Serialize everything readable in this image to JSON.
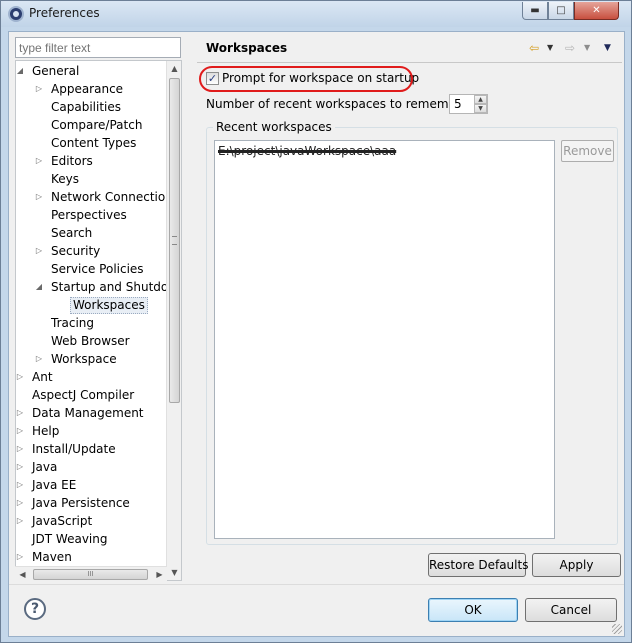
{
  "window": {
    "title": "Preferences",
    "min_glyph": "▬",
    "max_glyph": "□",
    "close_glyph": "✕"
  },
  "left": {
    "filter_placeholder": "type filter text",
    "tree": [
      {
        "label": "General",
        "depth": 0,
        "state": "expanded"
      },
      {
        "label": "Appearance",
        "depth": 1,
        "state": "collapsed"
      },
      {
        "label": "Capabilities",
        "depth": 1,
        "state": "leaf"
      },
      {
        "label": "Compare/Patch",
        "depth": 1,
        "state": "leaf"
      },
      {
        "label": "Content Types",
        "depth": 1,
        "state": "leaf"
      },
      {
        "label": "Editors",
        "depth": 1,
        "state": "collapsed"
      },
      {
        "label": "Keys",
        "depth": 1,
        "state": "leaf"
      },
      {
        "label": "Network Connection",
        "depth": 1,
        "state": "collapsed"
      },
      {
        "label": "Perspectives",
        "depth": 1,
        "state": "leaf"
      },
      {
        "label": "Search",
        "depth": 1,
        "state": "leaf"
      },
      {
        "label": "Security",
        "depth": 1,
        "state": "collapsed"
      },
      {
        "label": "Service Policies",
        "depth": 1,
        "state": "leaf"
      },
      {
        "label": "Startup and Shutdown",
        "depth": 1,
        "state": "expanded"
      },
      {
        "label": "Workspaces",
        "depth": 2,
        "state": "leaf",
        "selected": true
      },
      {
        "label": "Tracing",
        "depth": 1,
        "state": "leaf"
      },
      {
        "label": "Web Browser",
        "depth": 1,
        "state": "leaf"
      },
      {
        "label": "Workspace",
        "depth": 1,
        "state": "collapsed"
      },
      {
        "label": "Ant",
        "depth": 0,
        "state": "collapsed"
      },
      {
        "label": "AspectJ Compiler",
        "depth": 0,
        "state": "leaf"
      },
      {
        "label": "Data Management",
        "depth": 0,
        "state": "collapsed"
      },
      {
        "label": "Help",
        "depth": 0,
        "state": "collapsed"
      },
      {
        "label": "Install/Update",
        "depth": 0,
        "state": "collapsed"
      },
      {
        "label": "Java",
        "depth": 0,
        "state": "collapsed"
      },
      {
        "label": "Java EE",
        "depth": 0,
        "state": "collapsed"
      },
      {
        "label": "Java Persistence",
        "depth": 0,
        "state": "collapsed"
      },
      {
        "label": "JavaScript",
        "depth": 0,
        "state": "collapsed"
      },
      {
        "label": "JDT Weaving",
        "depth": 0,
        "state": "leaf"
      },
      {
        "label": "Maven",
        "depth": 0,
        "state": "collapsed"
      }
    ],
    "hscroll_grip": "III"
  },
  "page": {
    "title": "Workspaces",
    "prompt_label": "Prompt for workspace on startup",
    "prompt_checked": true,
    "check_glyph": "✓",
    "recent_label": "Number of recent workspaces to remember:",
    "recent_value": "5",
    "group_title": "Recent workspaces",
    "workspaces": [
      "E:\\project\\javaWorkspace\\aaa"
    ],
    "remove_label": "Remove",
    "restore_label": "Restore Defaults",
    "apply_label": "Apply"
  },
  "footer": {
    "help_glyph": "?",
    "ok_label": "OK",
    "cancel_label": "Cancel"
  },
  "colors": {
    "highlight_ring": "#e01b1b",
    "back_arrow": "#d49b1a"
  }
}
